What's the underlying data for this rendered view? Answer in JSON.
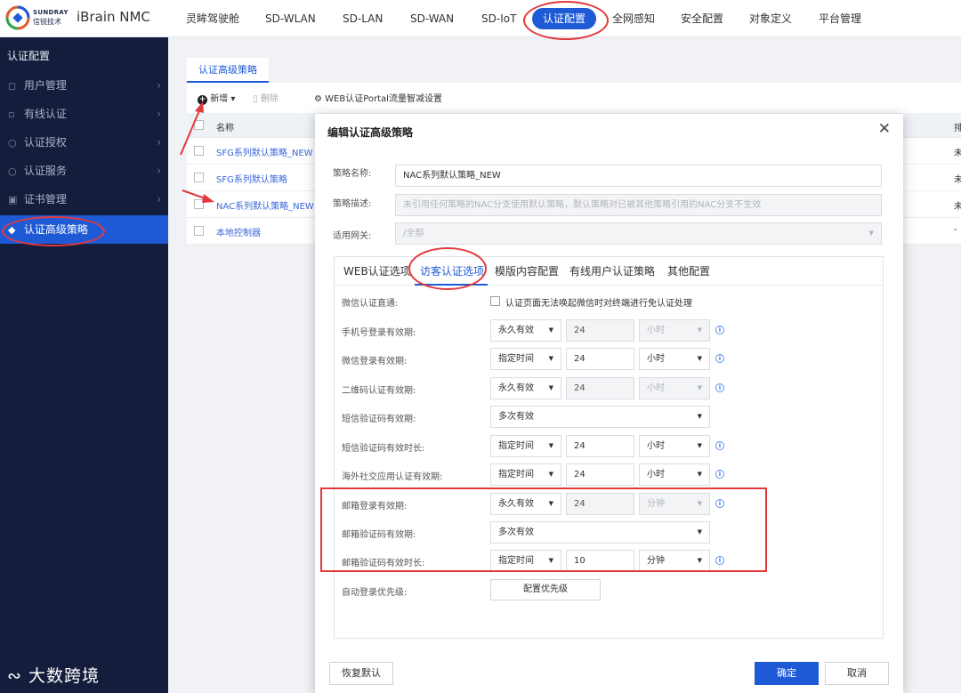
{
  "brand": {
    "en": "SUNDRAY",
    "cn": "信锐技术",
    "product": "iBrain NMC"
  },
  "topnav": [
    "灵眸驾驶舱",
    "SD-WLAN",
    "SD-LAN",
    "SD-WAN",
    "SD-IoT",
    "认证配置",
    "全网感知",
    "安全配置",
    "对象定义",
    "平台管理"
  ],
  "topnav_active": "认证配置",
  "sidebar": {
    "title": "认证配置",
    "items": [
      {
        "label": "用户管理",
        "icon": "user-icon"
      },
      {
        "label": "有线认证",
        "icon": "wired-icon"
      },
      {
        "label": "认证授权",
        "icon": "authorize-icon"
      },
      {
        "label": "认证服务",
        "icon": "service-icon"
      },
      {
        "label": "证书管理",
        "icon": "certificate-icon"
      },
      {
        "label": "认证高级策略",
        "icon": "policy-icon"
      }
    ],
    "active": "认证高级策略"
  },
  "watermark": "大数跨境",
  "page": {
    "tab": "认证高级策略",
    "toolbar": {
      "add": "新增",
      "delete": "删除",
      "portal": "WEB认证Portal流量智减设置"
    },
    "grid": {
      "header_name": "名称",
      "header_right": "排",
      "rows": [
        {
          "name": "SFG系列默认策略_NEW",
          "right": "未"
        },
        {
          "name": "SFG系列默认策略",
          "right": "未"
        },
        {
          "name": "NAC系列默认策略_NEW",
          "right": "未"
        },
        {
          "name": "本地控制器",
          "right": "-"
        }
      ]
    }
  },
  "modal": {
    "title": "编辑认证高级策略",
    "close": "✕",
    "policy_name_label": "策略名称:",
    "policy_name_value": "NAC系列默认策略_NEW",
    "policy_desc_label": "策略描述:",
    "policy_desc_value": "未引用任何策略的NAC分支使用默认策略，默认策略对已被其他策略引用的NAC分支不生效",
    "gateway_label": "适用网关:",
    "gateway_value": "/全部",
    "tabs": [
      "WEB认证选项",
      "访客认证选项",
      "模版内容配置",
      "有线用户认证策略",
      "其他配置"
    ],
    "active_tab": "访客认证选项",
    "wechat_direct_label": "微信认证直通:",
    "wechat_direct_text": "认证页面无法唤起微信时对终端进行免认证处理",
    "rows": [
      {
        "label": "手机号登录有效期:",
        "mode": "永久有效",
        "num": "24",
        "unit": "小时",
        "disabled": true
      },
      {
        "label": "微信登录有效期:",
        "mode": "指定时间",
        "num": "24",
        "unit": "小时",
        "disabled": false
      },
      {
        "label": "二维码认证有效期:",
        "mode": "永久有效",
        "num": "24",
        "unit": "小时",
        "disabled": true
      },
      {
        "label": "短信验证码有效期:",
        "mode": "多次有效",
        "wide": true
      },
      {
        "label": "短信验证码有效时长:",
        "mode": "指定时间",
        "num": "24",
        "unit": "小时",
        "disabled": false
      },
      {
        "label": "海外社交应用认证有效期:",
        "mode": "指定时间",
        "num": "24",
        "unit": "小时",
        "disabled": false
      },
      {
        "label": "邮箱登录有效期:",
        "mode": "永久有效",
        "num": "24",
        "unit": "分钟",
        "disabled": true
      },
      {
        "label": "邮箱验证码有效期:",
        "mode": "多次有效",
        "wide": true
      },
      {
        "label": "邮箱验证码有效时长:",
        "mode": "指定时间",
        "num": "10",
        "unit": "分钟",
        "disabled": false
      }
    ],
    "auto_login_label": "自动登录优先级:",
    "auto_login_button": "配置优先级",
    "restore_button": "恢复默认",
    "ok_button": "确定",
    "cancel_button": "取消"
  },
  "colors": {
    "primary": "#1e5ad6",
    "sidebar_bg": "#141d3b",
    "annotation": "#e3393c"
  }
}
